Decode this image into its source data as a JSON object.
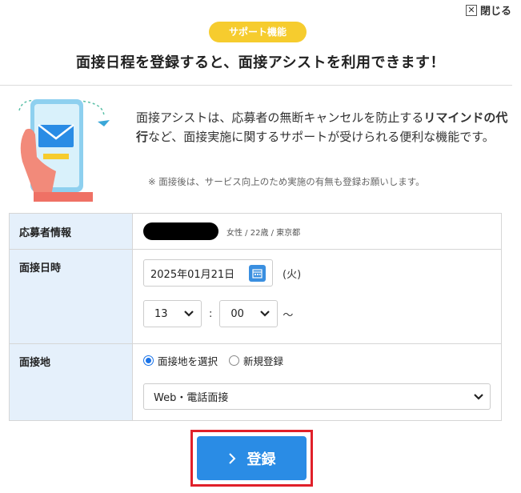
{
  "header": {
    "close_label": "閉じる",
    "badge": "サポート機能",
    "headline": "面接日程を登録すると、面接アシストを利用できます！"
  },
  "intro": {
    "text_1": "面接アシストは、応募者の無断キャンセルを防止する",
    "text_bold": "リマインドの代行",
    "text_2": "など、面接実施に関するサポートが受けられる便利な機能です。",
    "note": "※ 面接後は、サービス向上のため実施の有無も登録お願いします。"
  },
  "form": {
    "applicant": {
      "label": "応募者情報",
      "meta": "女性 / 22歳 / 東京都"
    },
    "datetime": {
      "label": "面接日時",
      "date_value": "2025年01月21日",
      "weekday": "(火)",
      "hour": "13",
      "colon": ":",
      "minute": "00",
      "tilde": "～"
    },
    "place": {
      "label": "面接地",
      "options": [
        "面接地を選択",
        "新規登録"
      ],
      "selected_option": "面接地を選択",
      "select_value": "Web・電話面接"
    }
  },
  "submit": {
    "label": "登録"
  },
  "colors": {
    "badge": "#f6cc2e",
    "label_bg": "#e5f0fb",
    "primary": "#2a8ce5",
    "highlight_frame": "#e0202a"
  },
  "icons": {
    "close": "close-icon",
    "calendar": "calendar-icon",
    "chevron": "chevron-down-icon",
    "submit_arrow": "chevron-right-icon"
  }
}
